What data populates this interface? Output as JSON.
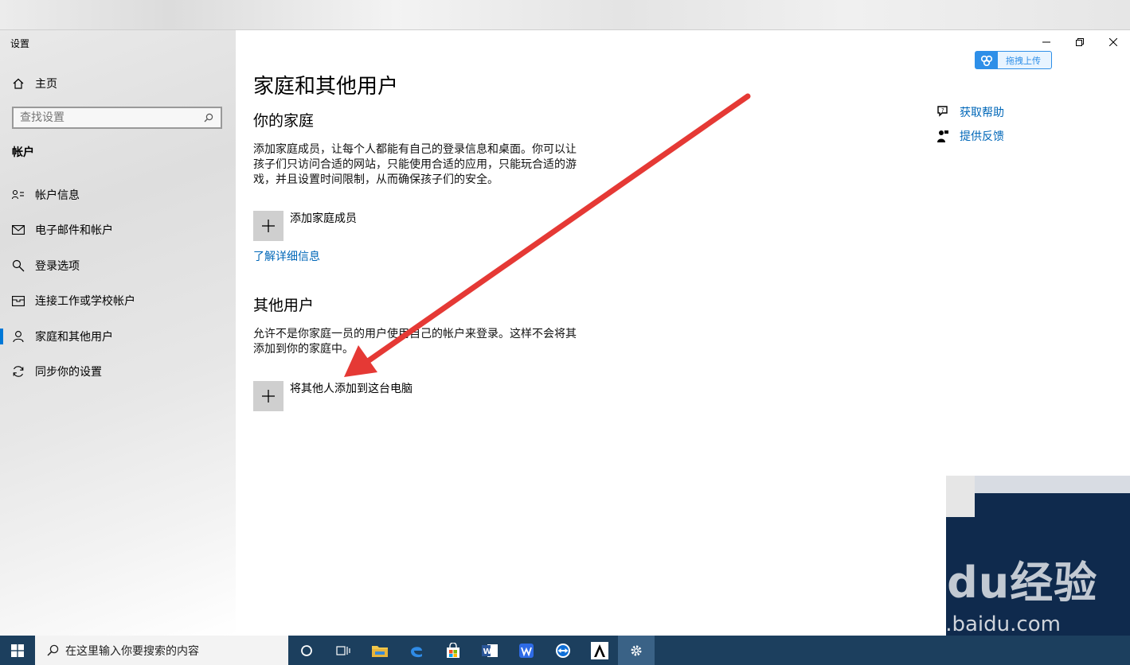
{
  "window": {
    "title": "设置",
    "controls": {
      "minimize": "—",
      "maximize": "□",
      "close": "✕"
    }
  },
  "upload_badge": {
    "label": "拖拽上传",
    "icon": "cloud-icon"
  },
  "sidebar": {
    "home_label": "主页",
    "search_placeholder": "查找设置",
    "section_title": "帐户",
    "items": [
      {
        "label": "帐户信息",
        "icon": "account-info-icon"
      },
      {
        "label": "电子邮件和帐户",
        "icon": "mail-icon"
      },
      {
        "label": "登录选项",
        "icon": "key-icon"
      },
      {
        "label": "连接工作或学校帐户",
        "icon": "briefcase-icon"
      },
      {
        "label": "家庭和其他用户",
        "icon": "person-icon",
        "active": true
      },
      {
        "label": "同步你的设置",
        "icon": "sync-icon"
      }
    ]
  },
  "main": {
    "title": "家庭和其他用户",
    "family": {
      "heading": "你的家庭",
      "description": "添加家庭成员，让每个人都能有自己的登录信息和桌面。你可以让孩子们只访问合适的网站，只能使用合适的应用，只能玩合适的游戏，并且设置时间限制，从而确保孩子们的安全。",
      "add_label": "添加家庭成员",
      "learn_more": "了解详细信息"
    },
    "others": {
      "heading": "其他用户",
      "description": "允许不是你家庭一员的用户使用自己的帐户来登录。这样不会将其添加到你的家庭中。",
      "add_label": "将其他人添加到这台电脑"
    }
  },
  "right_panel": {
    "help_label": "获取帮助",
    "feedback_label": "提供反馈"
  },
  "annotation": {
    "arrow_color": "#e53935"
  },
  "watermark": {
    "text": "Baidu经验",
    "url": "jingyan.baidu.com"
  },
  "taskbar": {
    "search_placeholder": "在这里输入你要搜索的内容",
    "apps": [
      "cortana-icon",
      "task-view-icon",
      "file-explorer-icon",
      "edge-icon",
      "store-icon",
      "word-icon",
      "wps-icon",
      "teamviewer-icon",
      "app-a-icon",
      "settings-icon"
    ]
  },
  "colors": {
    "accent": "#0078d7",
    "link": "#0067b8",
    "taskbar": "#1c3f5e"
  }
}
